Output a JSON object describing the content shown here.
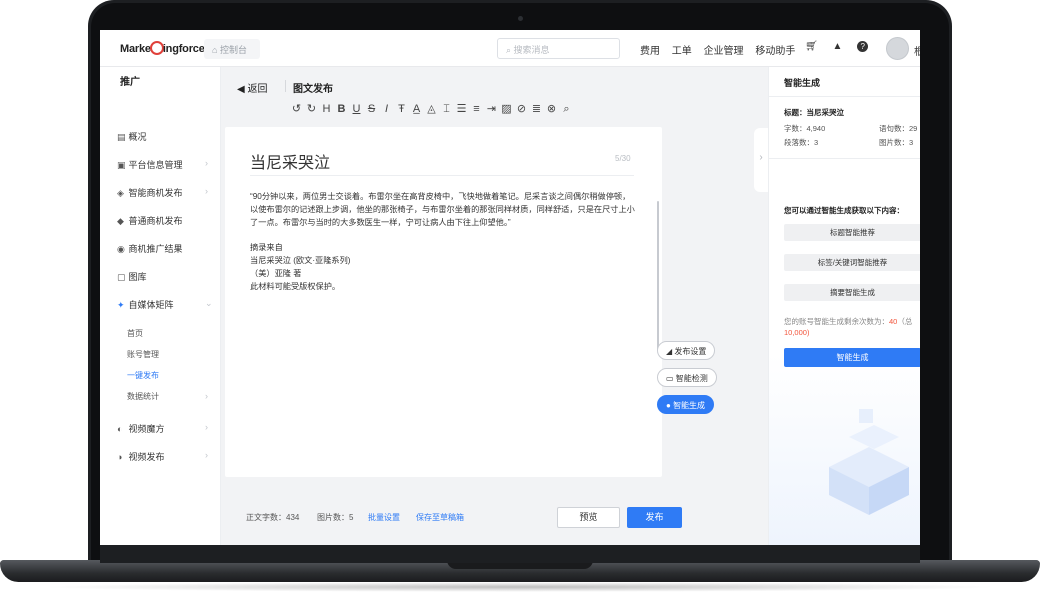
{
  "topbar": {
    "logo": "Marketingforce",
    "home": "控制台",
    "search_placeholder": "搜索消息",
    "nav": [
      "费用",
      "工单",
      "企业管理",
      "移动助手"
    ],
    "user": "根"
  },
  "sidebar": {
    "title": "推广",
    "items": [
      {
        "label": "概况",
        "icon": "chart-icon"
      },
      {
        "label": "平台信息管理",
        "icon": "info-icon"
      },
      {
        "label": "智能商机发布",
        "icon": "smart-icon"
      },
      {
        "label": "普通商机发布",
        "icon": "publish-icon"
      },
      {
        "label": "商机推广结果",
        "icon": "result-icon"
      },
      {
        "label": "图库",
        "icon": "gallery-icon"
      },
      {
        "label": "自媒体矩阵",
        "icon": "matrix-icon"
      },
      {
        "label": "视频魔方",
        "icon": "video-cube-icon"
      },
      {
        "label": "视频发布",
        "icon": "video-publish-icon"
      }
    ],
    "sub_items": [
      "首页",
      "账号管理",
      "一键发布",
      "数据统计"
    ],
    "active_sub": "一键发布"
  },
  "editor": {
    "back": "返回",
    "page_title": "图文发布",
    "doc_title": "当尼采哭泣",
    "title_count": "5/30",
    "paragraph": "“90分钟以来，两位男士交谈着。布雷尔坐在高背皮椅中，飞快地做着笔记。尼采言谈之间偶尔稍做停顿，以使布雷尔的记述跟上步调，他坐的那张椅子，与布雷尔坐着的那张同样材质，同样舒适，只是在尺寸上小了一点。布雷尔与当时的大多数医生一样，宁可让病人由下往上仰望他。”",
    "source_lines": [
      "摘录来自",
      "当尼采哭泣 (欧文·亚隆系列)",
      "（美）亚隆 著",
      "此材料可能受版权保护。"
    ],
    "float_buttons": {
      "settings": "发布设置",
      "check": "智能检测",
      "generate": "智能生成"
    },
    "footer": {
      "word_count_label": "正文字数：",
      "word_count": "434",
      "image_count_label": "图片数：",
      "image_count": "5",
      "batch": "批量设置",
      "save_draft": "保存至草稿箱",
      "preview": "预览",
      "publish": "发布"
    }
  },
  "panel": {
    "title": "智能生成",
    "doc_title_label": "标题：",
    "doc_title": "当尼采哭泣",
    "word_count_label": "字数：",
    "word_count": "4,940",
    "sentence_label": "语句数：",
    "sentence_count": "29",
    "para_label": "段落数：",
    "para_count": "3",
    "image_label": "图片数：",
    "image_count": "3",
    "hint": "您可以通过智能生成获取以下内容：",
    "options": [
      "标题智能推荐",
      "标签/关键词智能推荐",
      "摘要智能生成"
    ],
    "quota_prefix": "您的账号智能生成剩余次数为：",
    "quota": "40",
    "quota_suffix": "（总",
    "quota_total": "10,000)",
    "generate": "智能生成"
  },
  "colors": {
    "accent": "#2f7bf5",
    "quota": "#f2553b"
  }
}
